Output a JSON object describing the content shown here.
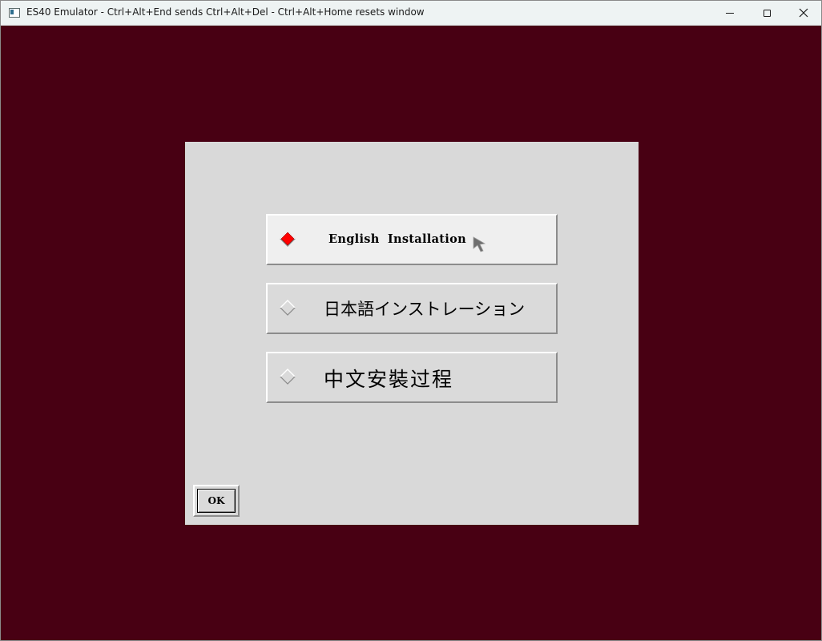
{
  "window": {
    "title": "ES40 Emulator - Ctrl+Alt+End sends Ctrl+Alt+Del - Ctrl+Alt+Home resets window",
    "icon": "app-window-icon",
    "controls": [
      "minimize-icon",
      "maximize-icon",
      "close-icon"
    ]
  },
  "installer": {
    "options": [
      {
        "label": "English  Installation",
        "selected": true
      },
      {
        "label": "日本語インストレーション",
        "selected": false
      },
      {
        "label": "中文安裝过程",
        "selected": false
      }
    ],
    "ok_label": "OK"
  },
  "colors": {
    "desktop_background": "#480013",
    "dialog_background": "#d9d9d9",
    "selected_indicator": "#ff0000",
    "title_bar": "#eef3f3"
  }
}
